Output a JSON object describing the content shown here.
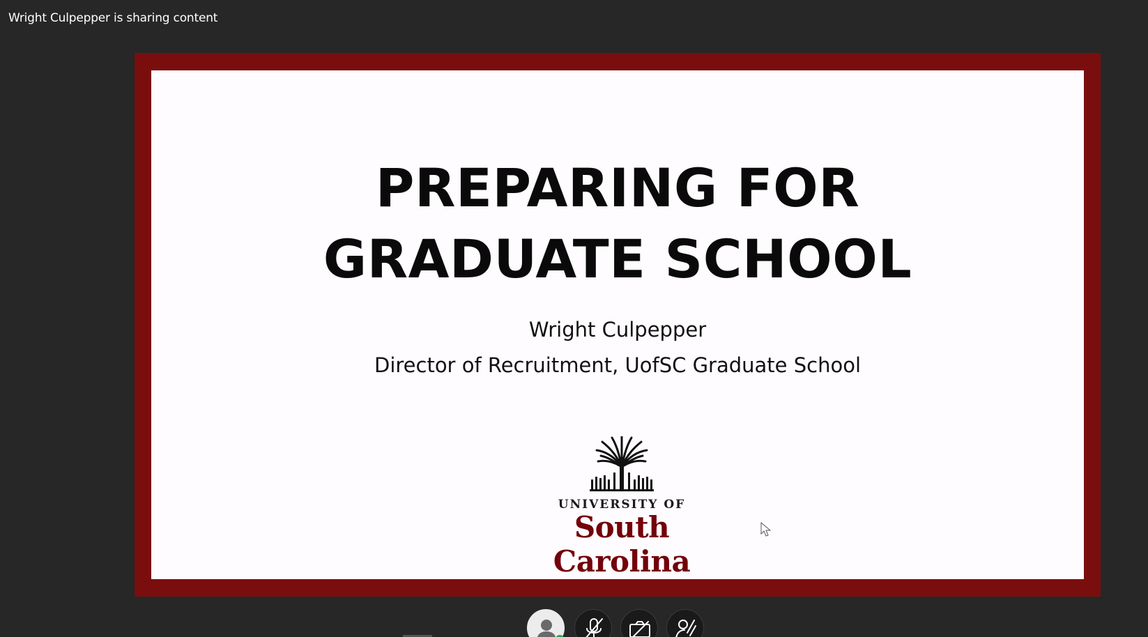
{
  "banner": {
    "sharing_text": "Wright Culpepper is sharing content"
  },
  "slide": {
    "title_line1": "PREPARING FOR",
    "title_line2": "GRADUATE SCHOOL",
    "presenter_name": "Wright Culpepper",
    "presenter_role": "Director of Recruitment, UofSC Graduate School",
    "logo_university": "UNIVERSITY OF",
    "logo_name": "South Carolina"
  },
  "controls": {
    "avatar_icon": "user-avatar-icon",
    "mute_icon": "microphone-muted-icon",
    "camera_icon": "camera-off-icon",
    "share_icon": "raise-hand-icon"
  },
  "colors": {
    "background": "#272727",
    "frame": "#7a0e0e",
    "garnet": "#73000a",
    "status_green": "#1fa855"
  }
}
